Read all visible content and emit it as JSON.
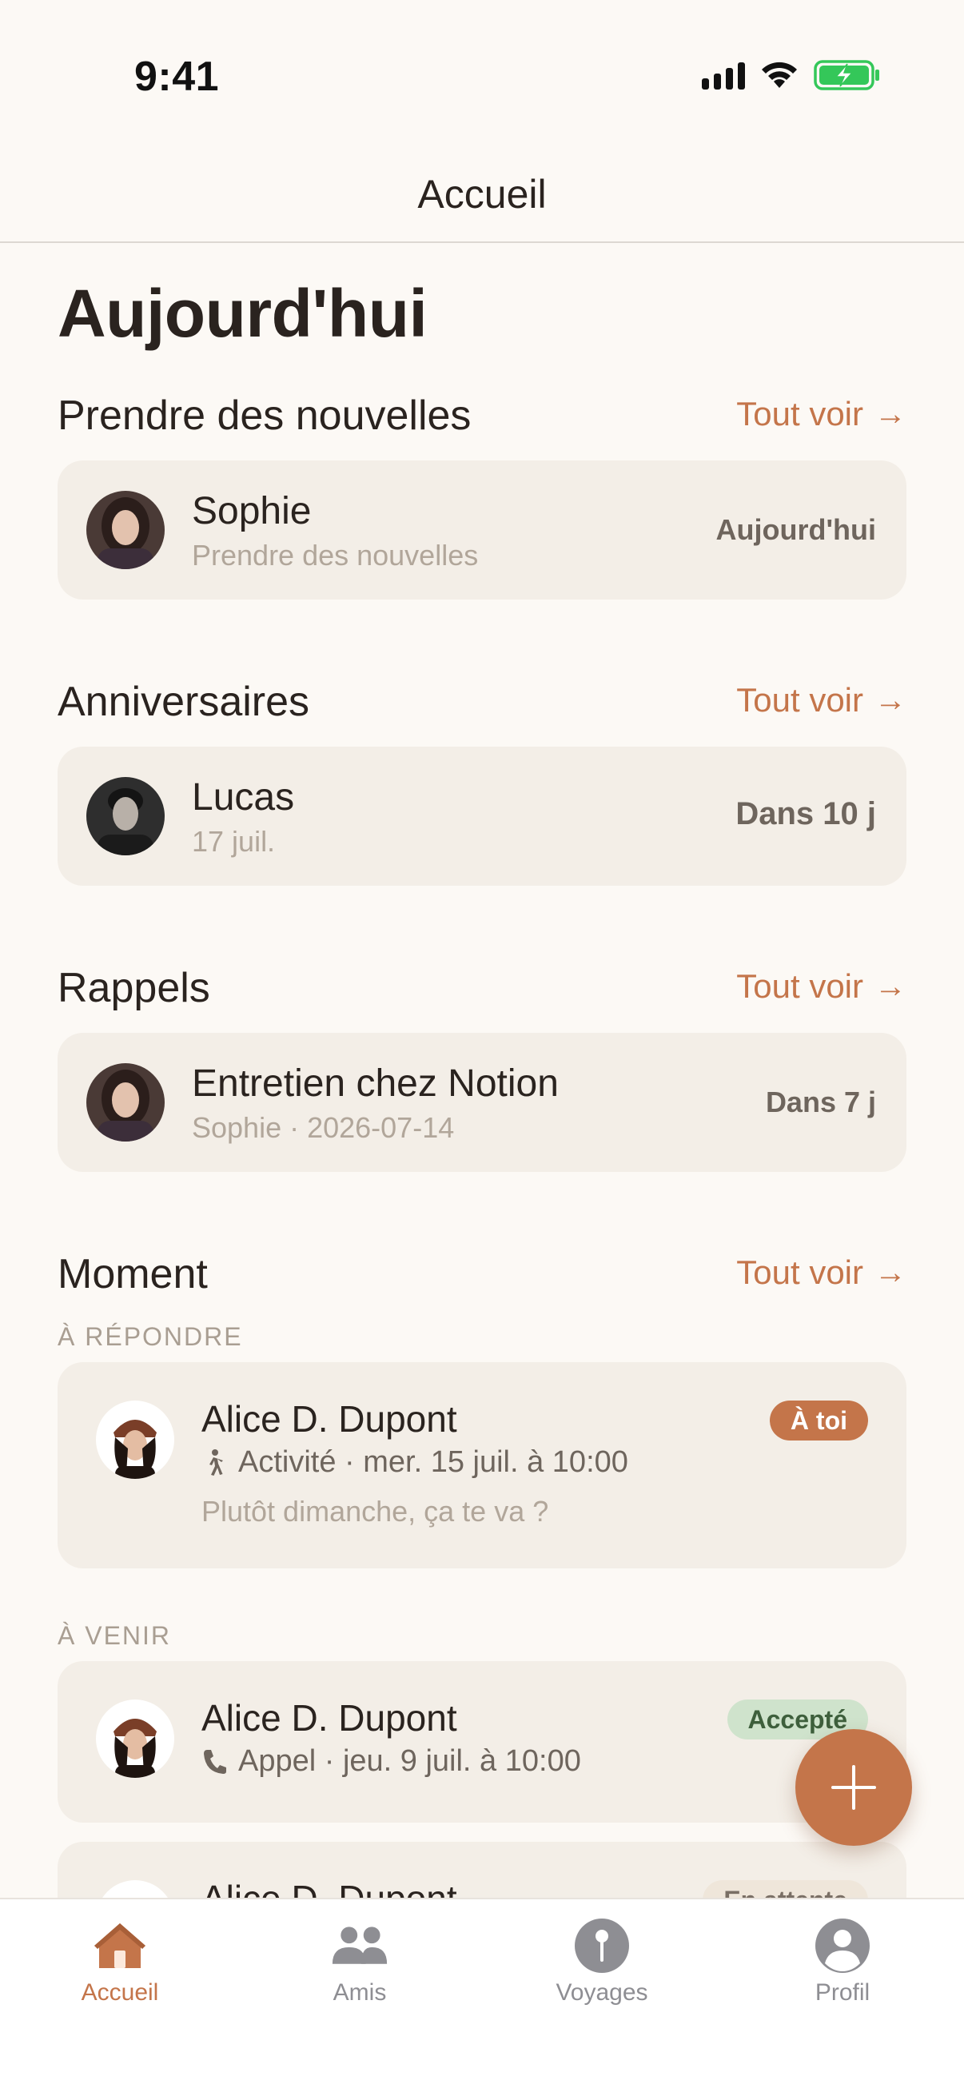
{
  "status_bar": {
    "time": "9:41"
  },
  "header": {
    "title": "Accueil"
  },
  "page": {
    "heading": "Aujourd'hui"
  },
  "sections": {
    "checkin": {
      "title": "Prendre des nouvelles",
      "see_all": "Tout voir",
      "item": {
        "name": "Sophie",
        "subtitle": "Prendre des nouvelles",
        "trailing": "Aujourd'hui"
      }
    },
    "birthdays": {
      "title": "Anniversaires",
      "see_all": "Tout voir",
      "item": {
        "name": "Lucas",
        "subtitle": "17 juil.",
        "trailing": "Dans 10 j"
      }
    },
    "reminders": {
      "title": "Rappels",
      "see_all": "Tout voir",
      "item": {
        "title": "Entretien chez Notion",
        "subtitle": "Sophie · 2026-07-14",
        "trailing": "Dans 7 j"
      }
    },
    "moment": {
      "title": "Moment",
      "see_all": "Tout voir",
      "to_answer_label": "À RÉPONDRE",
      "to_answer": {
        "name": "Alice D. Dupont",
        "badge": "À toi",
        "meta": "Activité · mer. 15 juil. à 10:00",
        "meta_icon": "walking-icon",
        "message": "Plutôt dimanche, ça te va ?"
      },
      "upcoming_label": "À VENIR",
      "upcoming": [
        {
          "name": "Alice D. Dupont",
          "badge": "Accepté",
          "meta": "Appel · jeu. 9 juil. à 10:00",
          "meta_icon": "phone-icon"
        },
        {
          "name": "Alice D. Dupont",
          "badge": "En attente"
        }
      ]
    }
  },
  "tabs": [
    {
      "label": "Accueil",
      "icon": "home-icon",
      "active": true
    },
    {
      "label": "Amis",
      "icon": "people-icon",
      "active": false
    },
    {
      "label": "Voyages",
      "icon": "pin-icon",
      "active": false
    },
    {
      "label": "Profil",
      "icon": "person-icon",
      "active": false
    }
  ],
  "colors": {
    "accent": "#C4754A",
    "background": "#FCF9F5",
    "card": "#F3EEE7",
    "accepted_bg": "#CFE3CC"
  }
}
